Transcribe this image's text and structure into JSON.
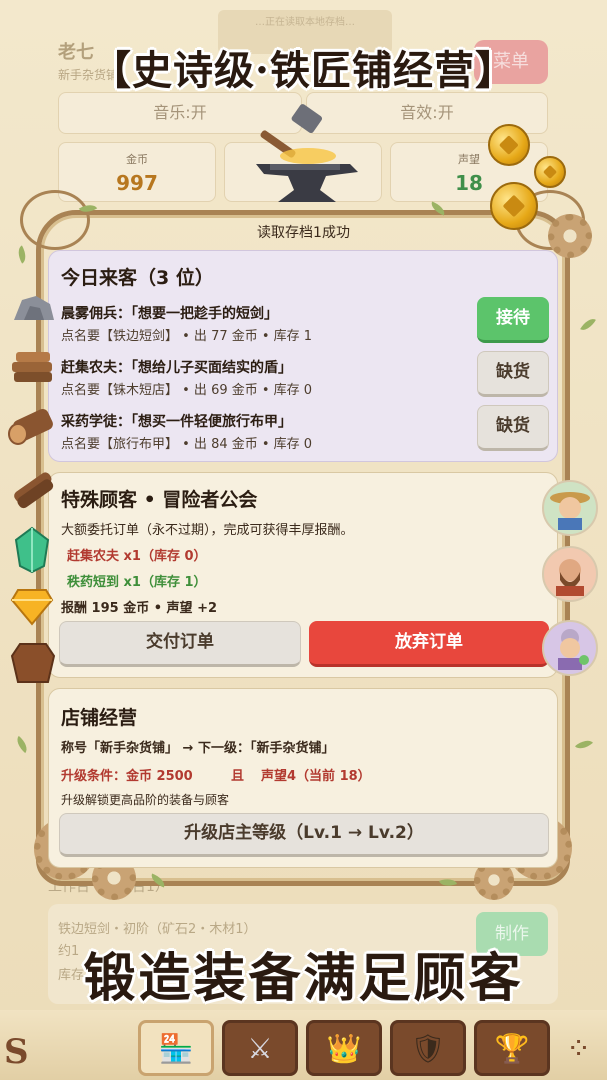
{
  "background": {
    "toast_ghost": "…正在读取本地存档…",
    "player_name": "老七",
    "player_title": "新手杂货铺",
    "top_red_button": "菜单",
    "music": "音乐:开",
    "sound": "音效:开",
    "stats": [
      {
        "label": "金币",
        "value": "997",
        "color": "#b7771f"
      },
      {
        "label": "声望",
        "value": "18",
        "color": "#3f8f4a"
      }
    ],
    "workshop_label": "工作台（锻造台1）",
    "workshop_item": "铁边短剑・初阶（矿石2・木材1）",
    "workshop_sub1": "约1",
    "workshop_sub2": "库存",
    "make_button": "制作"
  },
  "banner_top": "【史诗级·铁匠铺经营】",
  "banner_bottom": "锻造装备满足顾客",
  "toast": "读取存档1成功",
  "visitors": {
    "title": "今日来客（3 位）",
    "customers": [
      {
        "line": "晨雾佣兵：「想要一把趁手的短剑」",
        "sub": "点名要【铁边短剑】 • 出 77 金币 • 库存 1",
        "button": "接待",
        "style": "green"
      },
      {
        "line": "赶集农夫：「想给儿子买面结实的盾」",
        "sub": "点名要【铢木短店】 • 出 69 金币 • 库存 0",
        "button": "缺货",
        "style": "gray"
      },
      {
        "line": "采药学徒：「想买一件轻便旅行布甲」",
        "sub": "点名要【旅行布甲】 • 出 84 金币 • 库存 0",
        "button": "缺货",
        "style": "gray"
      }
    ]
  },
  "special": {
    "title": "特殊顾客 • 冒险者公会",
    "desc": "大额委托订单（永不过期），完成可获得丰厚报酬。",
    "req1": "赶集农夫 x1（库存 0）",
    "req2": "秩药短到 x1（库存 1）",
    "reward": "报酬 195 金币 • 声望 +2",
    "deliver": "交付订单",
    "abandon": "放弃订单"
  },
  "shop": {
    "title": "店铺经营",
    "rank": "称号「新手杂货铺」 → 下一级：「新手杂货铺」",
    "cond_label": "升级条件：金币 2500",
    "cond_and": "且",
    "cond_rep": "声望4（当前 18）",
    "unlock": "升级解锁更高品阶的装备与顾客",
    "upgrade_button": "升级店主等级（Lv.1 → Lv.2）"
  },
  "tabs": [
    {
      "icon": "shop-icon",
      "glyph": "🏪"
    },
    {
      "icon": "crossed-swords-icon",
      "glyph": "⚔"
    },
    {
      "icon": "crown-icon",
      "glyph": "👑"
    },
    {
      "icon": "shield-badge-icon",
      "glyph": "🛡"
    },
    {
      "icon": "trophy-icon",
      "glyph": "🏆"
    }
  ],
  "corner_left": "S",
  "corner_right": "⁘"
}
